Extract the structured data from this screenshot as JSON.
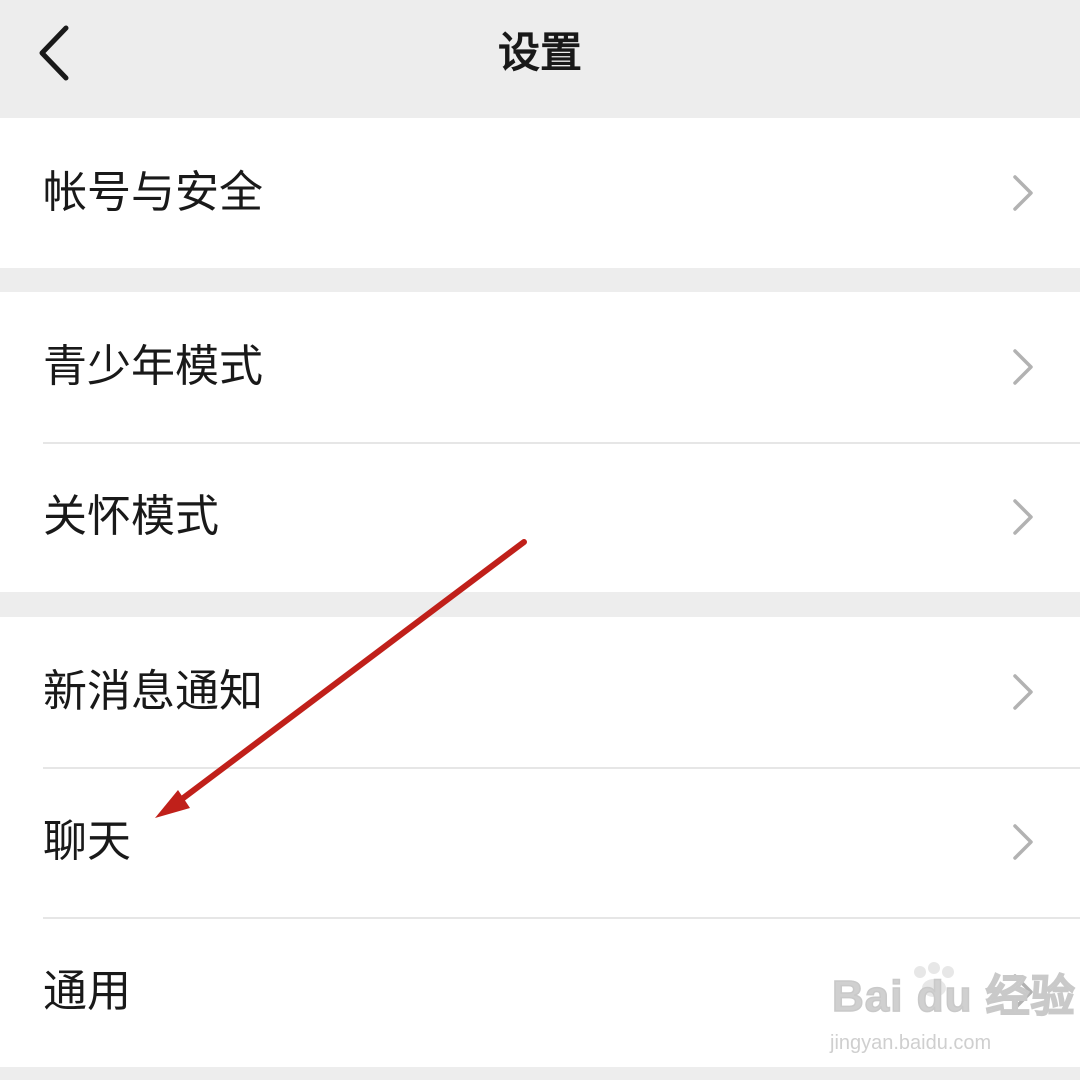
{
  "header": {
    "title": "设置",
    "back_icon": "chevron-left-icon"
  },
  "groups": [
    {
      "items": [
        {
          "label": "帐号与安全"
        }
      ]
    },
    {
      "items": [
        {
          "label": "青少年模式"
        },
        {
          "label": "关怀模式"
        }
      ]
    },
    {
      "items": [
        {
          "label": "新消息通知"
        },
        {
          "label": "聊天"
        },
        {
          "label": "通用"
        }
      ]
    }
  ],
  "annotation": {
    "icon": "arrow-icon",
    "color": "#c0201a",
    "target": "聊天"
  },
  "watermark": {
    "logo_text": "Bai du 经验",
    "url": "jingyan.baidu.com"
  },
  "colors": {
    "background": "#ededed",
    "row": "#ffffff",
    "text": "#191919",
    "chevron": "#b2b2b2"
  }
}
